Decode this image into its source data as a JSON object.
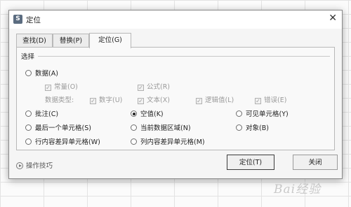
{
  "window": {
    "app_icon_letter": "S",
    "title": "定位"
  },
  "tabs": [
    {
      "label": "查找(D)",
      "active": false
    },
    {
      "label": "替换(P)",
      "active": false
    },
    {
      "label": "定位(G)",
      "active": true
    }
  ],
  "group": {
    "label": "选择"
  },
  "options": {
    "data": {
      "label": "数据(A)",
      "selected": false
    },
    "constants": {
      "label": "常量(O)",
      "checked": true,
      "disabled": true
    },
    "formulas": {
      "label": "公式(R)",
      "checked": true,
      "disabled": true
    },
    "data_type_label": "数据类型:",
    "number": {
      "label": "数字(U)",
      "checked": true,
      "disabled": true
    },
    "text": {
      "label": "文本(X)",
      "checked": true,
      "disabled": true
    },
    "logical": {
      "label": "逻辑值(L)",
      "checked": true,
      "disabled": true
    },
    "error": {
      "label": "错误(E)",
      "checked": true,
      "disabled": true
    },
    "comments": {
      "label": "批注(C)",
      "selected": false
    },
    "blanks": {
      "label": "空值(K)",
      "selected": true
    },
    "visible_cells": {
      "label": "可见单元格(Y)",
      "selected": false
    },
    "last_cell": {
      "label": "最后一个单元格(S)",
      "selected": false
    },
    "current_region": {
      "label": "当前数据区域(N)",
      "selected": false
    },
    "objects": {
      "label": "对象(B)",
      "selected": false
    },
    "row_differences": {
      "label": "行内容差异单元格(W)",
      "selected": false
    },
    "column_differences": {
      "label": "列内容差异单元格(M)",
      "selected": false
    }
  },
  "footer": {
    "tips_label": "操作技巧",
    "ok_label": "定位(T)",
    "close_label": "关闭"
  },
  "watermark": "Bai经验"
}
